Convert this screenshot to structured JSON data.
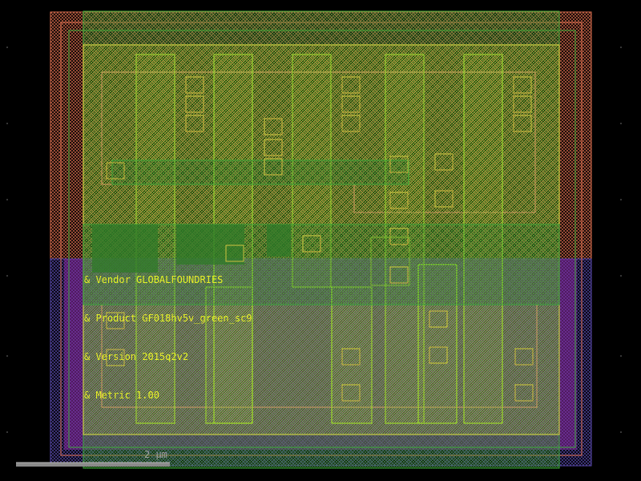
{
  "annotations": [
    {
      "text": "& Vendor GLOBALFOUNDRIES"
    },
    {
      "text": "& Product GF018hv5v_green_sc9"
    },
    {
      "text": "& Version 2015q2v2"
    },
    {
      "text": "& Metric 1.00"
    }
  ],
  "scale_bar": {
    "label": "2 µm"
  },
  "colors": {
    "background": "#000000",
    "label": "#e8ef2a",
    "scale_label": "#a0a0a0",
    "nwell": "#e07050",
    "pwell": "#6a5acd",
    "boundary": "#3aa838",
    "diffusion": "#7fbf30",
    "poly": "#b8e040",
    "contact": "#c8d040",
    "metal": "#d0a060",
    "implant": "#b040c0"
  }
}
